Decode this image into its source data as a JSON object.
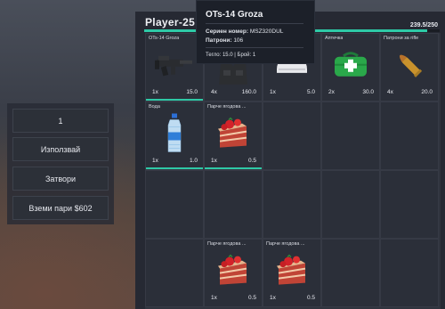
{
  "context_menu": {
    "quantity": "1",
    "use_label": "Използвай",
    "close_label": "Затвори",
    "take_money_label": "Вземи пари $602"
  },
  "inventory": {
    "player_name": "Player-25",
    "weight": "239.5/250",
    "weight_fraction": 0.958,
    "accent_color": "#2ec9a6",
    "slots": [
      {
        "label": "OTs-14 Groza",
        "count": "1x",
        "weight": "15.0",
        "icon": "rifle-icon",
        "durability": 1.0
      },
      {
        "label": "",
        "count": "4x",
        "weight": "160.0",
        "icon": "vest-icon",
        "durability": 0
      },
      {
        "label": "",
        "count": "1x",
        "weight": "5.0",
        "icon": "helmet-icon",
        "durability": 0
      },
      {
        "label": "Аптечка",
        "count": "2x",
        "weight": "30.0",
        "icon": "medkit-icon",
        "durability": 0
      },
      {
        "label": "Патрони за rifle",
        "count": "4x",
        "weight": "20.0",
        "icon": "bullet-icon",
        "durability": 0
      },
      {
        "label": "Вода",
        "count": "1x",
        "weight": "1.0",
        "icon": "water-bottle-icon",
        "durability": 1.0
      },
      {
        "label": "Парче ягодова ...",
        "count": "1x",
        "weight": "0.5",
        "icon": "cake-icon",
        "durability": 1.0
      },
      {
        "label": "Парче ягодова ...",
        "count": "1x",
        "weight": "0.5",
        "icon": "cake-icon",
        "durability": 0
      },
      {
        "label": "Парче ягодова ...",
        "count": "1x",
        "weight": "0.5",
        "icon": "cake-icon",
        "durability": 0
      }
    ]
  },
  "tooltip": {
    "title": "OTs-14 Groza",
    "serial_label": "Сериен номер:",
    "serial_value": "MSZ320DUL",
    "ammo_label": "Патрони:",
    "ammo_value": "106",
    "footer": "Тегло: 15.0 | Брой: 1"
  }
}
